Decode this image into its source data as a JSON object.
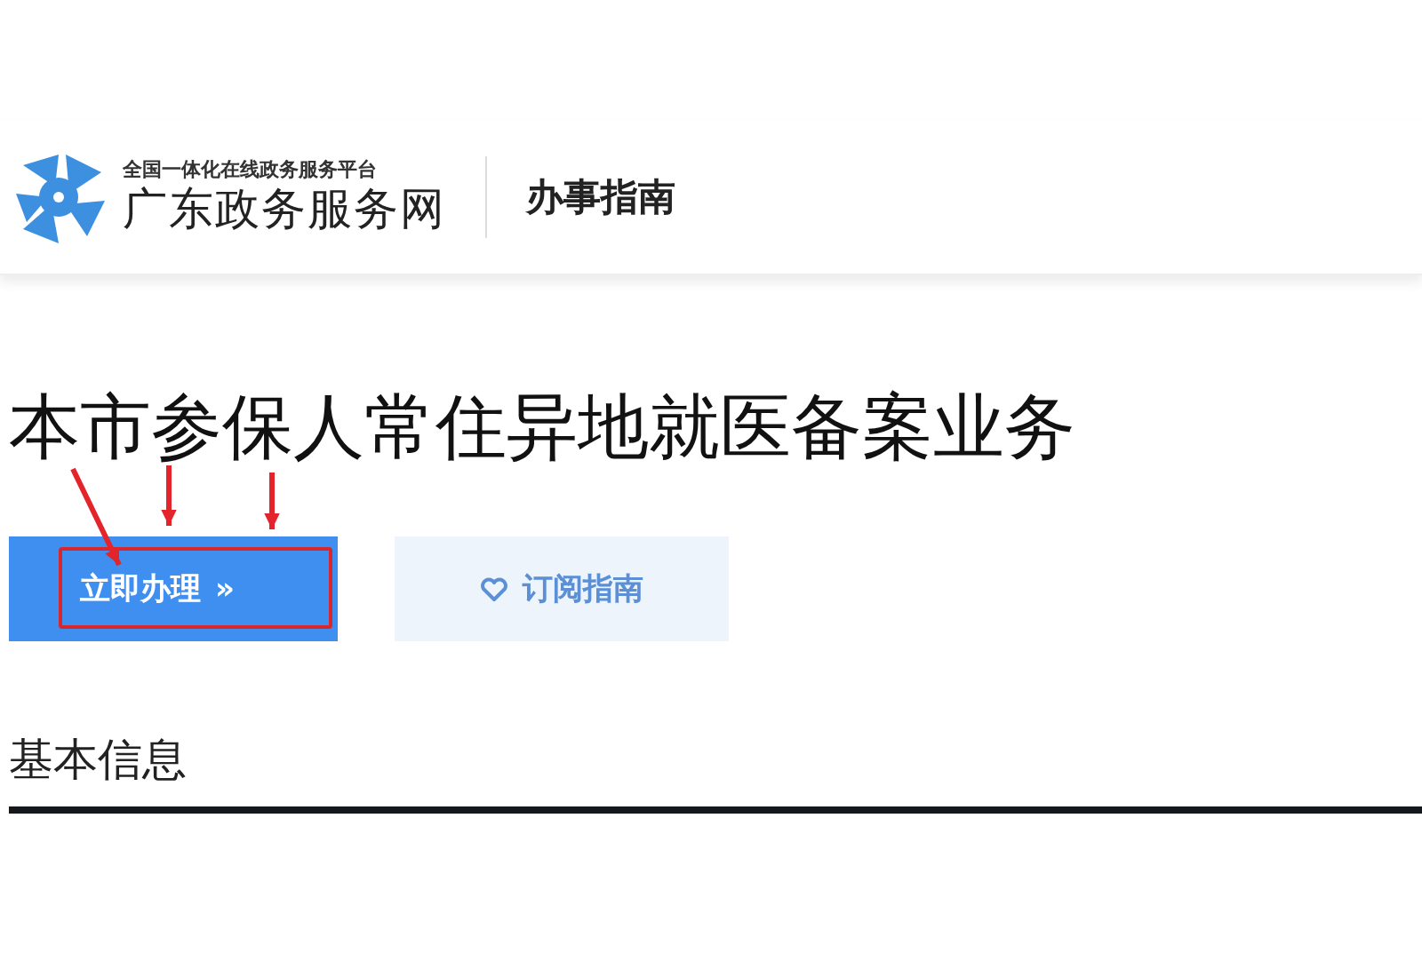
{
  "header": {
    "logo_tagline": "全国一体化在线政务服务平台",
    "logo_name": "广东政务服务网",
    "section": "办事指南"
  },
  "title": "本市参保人常住异地就医备案业务",
  "actions": [
    {
      "kind": "primary",
      "label": "立即办理",
      "suffix": "»",
      "highlighted": true
    },
    {
      "kind": "secondary",
      "label": "订阅指南",
      "highlighted": false
    }
  ],
  "section_heading": "基本信息"
}
